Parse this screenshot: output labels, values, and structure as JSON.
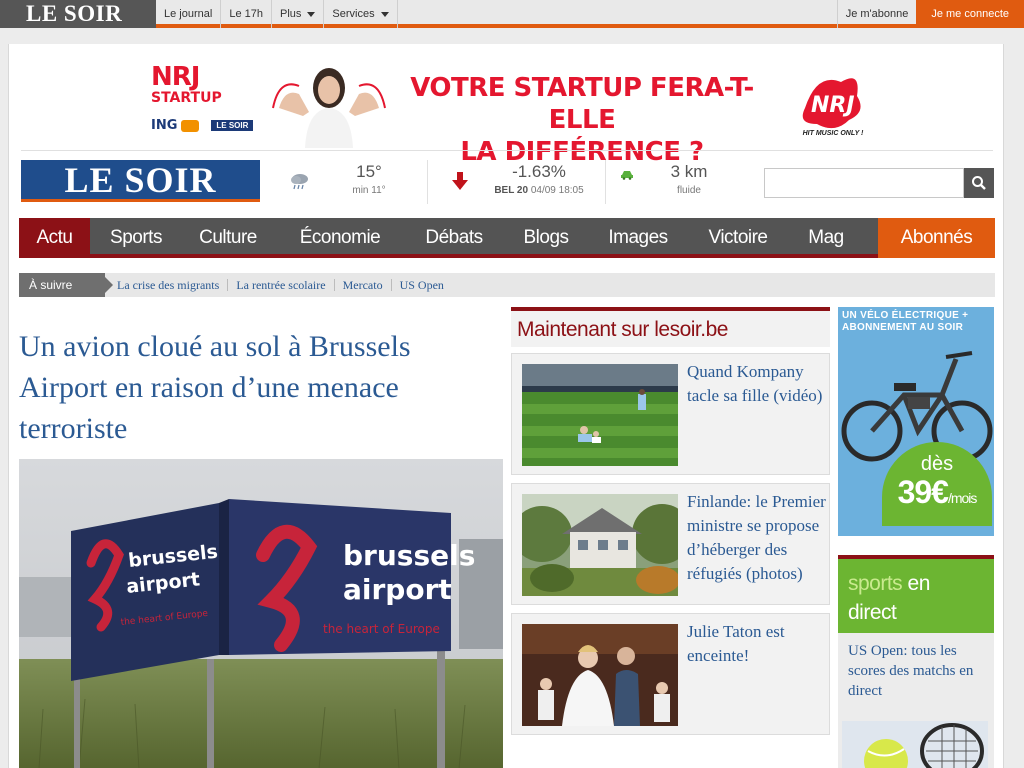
{
  "topbar": {
    "brand": "LE SOIR",
    "nav": [
      {
        "label": "Le journal",
        "dropdown": false
      },
      {
        "label": "Le 17h",
        "dropdown": false
      },
      {
        "label": "Plus",
        "dropdown": true
      },
      {
        "label": "Services",
        "dropdown": true
      }
    ],
    "subscribe": "Je m'abonne",
    "login": "Je me connecte"
  },
  "ad": {
    "nrj": "NRJ",
    "startup": "STARTUP",
    "ing": "ING",
    "partner": "LE SOIR",
    "headline_1": "VOTRE STARTUP FERA-T-ELLE",
    "headline_2": "LA DIFFÉRENCE ?",
    "slogan": "HIT MUSIC ONLY !"
  },
  "masthead": {
    "logo": "LE SOIR",
    "weather": {
      "temp": "15°",
      "min": "min 11°",
      "icon": "rain-cloud-icon"
    },
    "stock": {
      "change": "-1.63%",
      "index": "BEL 20",
      "when": "04/09 18:05",
      "direction": "down"
    },
    "traffic": {
      "distance": "3 km",
      "status": "fluide",
      "icon": "car-icon"
    },
    "search": {
      "placeholder": "",
      "value": ""
    }
  },
  "mainnav": [
    {
      "label": "Actu",
      "active": true
    },
    {
      "label": "Sports"
    },
    {
      "label": "Culture"
    },
    {
      "label": "Économie"
    },
    {
      "label": "Débats"
    },
    {
      "label": "Blogs"
    },
    {
      "label": "Images"
    },
    {
      "label": "Victoire"
    },
    {
      "label": "Mag"
    },
    {
      "label": "Abonnés",
      "highlight": true
    }
  ],
  "follow": {
    "label": "À suivre",
    "links": [
      "La crise des migrants",
      "La rentrée scolaire",
      "Mercato",
      "US Open"
    ]
  },
  "lead": {
    "title": "Un avion cloué au sol à Brussels Airport en raison d’une menace terroriste",
    "sign_brand_1": "brussels",
    "sign_brand_2": "airport",
    "sign_tag": "the heart of Europe"
  },
  "now": {
    "heading": "Maintenant sur lesoir.be",
    "items": [
      {
        "title": "Quand Kompany tacle sa fille (vidéo)"
      },
      {
        "title": "Finlande: le Premier ministre se propose d’héberger des réfugiés (photos)"
      },
      {
        "title": "Julie Taton est enceinte!"
      }
    ]
  },
  "side_ad": {
    "title": "UN VÉLO ÉLECTRIQUE + ABONNEMENT AU SOIR",
    "from": "dès",
    "price": "39€",
    "per": "/mois"
  },
  "live": {
    "word_1": "sports",
    "word_2": "en",
    "word_3": "direct",
    "text": "US Open: tous les scores des matchs en direct"
  },
  "colors": {
    "accent_orange": "#e05b10",
    "brand_red": "#8c1116",
    "brand_blue": "#1f4d8c",
    "link_blue": "#2b5a93",
    "sports_green": "#6cb532"
  }
}
